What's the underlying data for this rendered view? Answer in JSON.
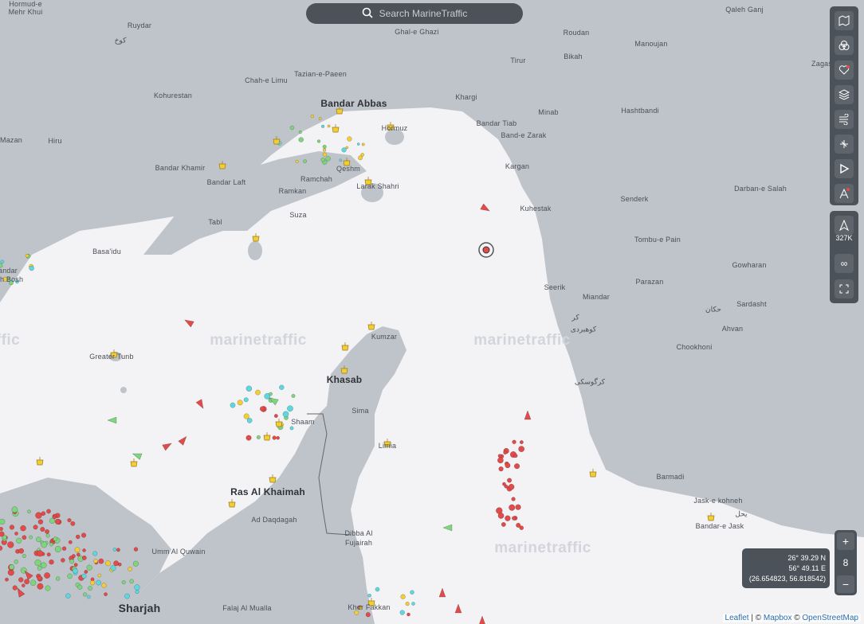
{
  "search": {
    "placeholder": "Search MarineTraffic"
  },
  "labels": [
    {
      "text": "Hormud-e",
      "k": "s"
    },
    {
      "text": "Mehr Khui",
      "k": "s"
    },
    {
      "text": "Ruydar",
      "k": "s"
    },
    {
      "text": "کوخ",
      "k": "s"
    },
    {
      "text": "Ghal-e Ghazi",
      "k": "s"
    },
    {
      "text": "Roudan",
      "k": "s"
    },
    {
      "text": "Manoujan",
      "k": "s"
    },
    {
      "text": "Qaleh Ganj",
      "k": "s"
    },
    {
      "text": "Tirur",
      "k": "s"
    },
    {
      "text": "Bikah",
      "k": "s"
    },
    {
      "text": "Zagashk",
      "k": "s"
    },
    {
      "text": "Tazian-e-Paeen",
      "k": "s"
    },
    {
      "text": "Chah-e Limu",
      "k": "s"
    },
    {
      "text": "Kohurestan",
      "k": "s"
    },
    {
      "text": "Bandar Abbas",
      "k": "c"
    },
    {
      "text": "Khargi",
      "k": "s"
    },
    {
      "text": "Minab",
      "k": "s"
    },
    {
      "text": "Hashtbandi",
      "k": "s"
    },
    {
      "text": "Hormuz",
      "k": "s"
    },
    {
      "text": "Bandar Tiab",
      "k": "s"
    },
    {
      "text": "Band-e Zarak",
      "k": "s"
    },
    {
      "text": "Mazan",
      "k": "s"
    },
    {
      "text": "Hiru",
      "k": "s"
    },
    {
      "text": "Bandar Khamir",
      "k": "s"
    },
    {
      "text": "Qeshm",
      "k": "s"
    },
    {
      "text": "Kargan",
      "k": "s"
    },
    {
      "text": "Ramchah",
      "k": "s"
    },
    {
      "text": "Bandar Laft",
      "k": "s"
    },
    {
      "text": "Ramkan",
      "k": "s"
    },
    {
      "text": "Larak Shahri",
      "k": "s"
    },
    {
      "text": "Senderk",
      "k": "s"
    },
    {
      "text": "Darban-e Salah",
      "k": "s"
    },
    {
      "text": "Kuhestak",
      "k": "s"
    },
    {
      "text": "Suza",
      "k": "s"
    },
    {
      "text": "Tabl",
      "k": "s"
    },
    {
      "text": "Tombu-e Pain",
      "k": "s"
    },
    {
      "text": "Basa'idu",
      "k": "s"
    },
    {
      "text": "Gowharan",
      "k": "s"
    },
    {
      "text": "Parazan",
      "k": "s"
    },
    {
      "text": "Seerik",
      "k": "s"
    },
    {
      "text": "Miandar",
      "k": "s"
    },
    {
      "text": "Sardasht",
      "k": "s"
    },
    {
      "text": "حکان",
      "k": "s"
    },
    {
      "text": "Ahvan",
      "k": "s"
    },
    {
      "text": "کوهبردی",
      "k": "s"
    },
    {
      "text": "کر",
      "k": "s"
    },
    {
      "text": "Chookhoni",
      "k": "s"
    },
    {
      "text": "Kumzar",
      "k": "s"
    },
    {
      "text": "Greater Tunb",
      "k": "s"
    },
    {
      "text": "Khasab",
      "k": "c"
    },
    {
      "text": "کرگوسکی",
      "k": "s"
    },
    {
      "text": "Sima",
      "k": "s"
    },
    {
      "text": "Shaam",
      "k": "s"
    },
    {
      "text": "Limia",
      "k": "s"
    },
    {
      "text": "Ras Al Khaimah",
      "k": "c"
    },
    {
      "text": "Barmadi",
      "k": "s"
    },
    {
      "text": "Ad Daqdagah",
      "k": "s"
    },
    {
      "text": "Jask-e kohneh",
      "k": "s"
    },
    {
      "text": "یحل",
      "k": "s"
    },
    {
      "text": "Bandar-e Jask",
      "k": "s"
    },
    {
      "text": "Dibba Al",
      "k": "s"
    },
    {
      "text": "Fujairah",
      "k": "s"
    },
    {
      "text": "Umm Al Quwain",
      "k": "s"
    },
    {
      "text": "Sharjah",
      "k": "b"
    },
    {
      "text": "Falaj Al Mualla",
      "k": "s"
    },
    {
      "text": "Khor Fakkan",
      "k": "s"
    },
    {
      "text": "andar",
      "k": "s"
    },
    {
      "text": "eh Bosh",
      "k": "s"
    }
  ],
  "watermarks": [
    "marinetraffic",
    "marinetraffic",
    "marinetraffic",
    "ffic"
  ],
  "toolbar": {
    "buttons": [
      {
        "icon": "map-icon"
      },
      {
        "icon": "filter-icon"
      },
      {
        "icon": "favorites-icon"
      },
      {
        "icon": "layers-icon"
      },
      {
        "icon": "weather-icon"
      },
      {
        "icon": "measure-icon"
      },
      {
        "icon": "playback-icon"
      },
      {
        "icon": "route-icon"
      }
    ],
    "position_icon": "my-location-icon",
    "vessel_count": "327K",
    "infinity_icon": "infinity-icon",
    "fullscreen_icon": "fullscreen-icon"
  },
  "zoom": {
    "plus": "+",
    "level": "8",
    "minus": "−"
  },
  "coords": {
    "lat": "26° 39.29 N",
    "lon": "56° 49.11 E",
    "decimal": "(26.654823, 56.818542)"
  },
  "attribution": {
    "leaflet": "Leaflet",
    "sep1": " | © ",
    "mapbox": "Mapbox",
    "sep2": " © ",
    "osm": "OpenStreetMap"
  },
  "colors": {
    "land": "#bfc4cb",
    "sea": "#f3f3f5",
    "toolbar": "#4b5259",
    "vessel_red": "#e34a4a",
    "vessel_green": "#7fd47f",
    "vessel_yellow": "#f2cd35",
    "vessel_cyan": "#5ed8e0"
  }
}
